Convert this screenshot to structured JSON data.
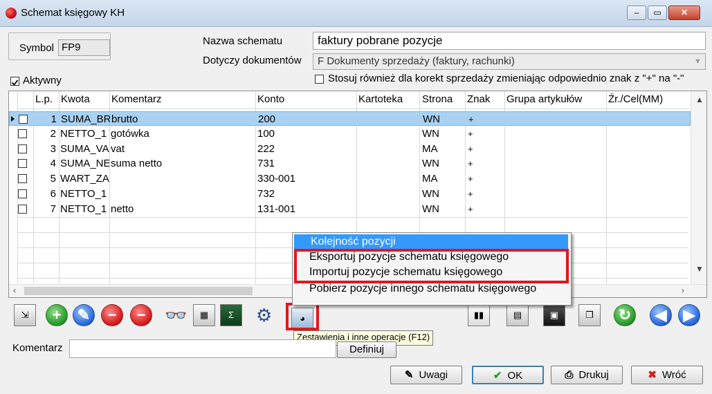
{
  "window": {
    "title": "Schemat księgowy KH",
    "controls": {
      "min": "–",
      "max": "▭",
      "close": "✕"
    }
  },
  "symbol": {
    "label": "Symbol",
    "value": "FP9"
  },
  "name": {
    "label": "Nazwa schematu",
    "value": "faktury pobrane pozycje"
  },
  "documents": {
    "label": "Dotyczy dokumentów",
    "value": "F  Dokumenty sprzedaży (faktury, rachunki)"
  },
  "active": {
    "label": "Aktywny",
    "checked": true
  },
  "correction": {
    "label": "Stosuj również dla korekt sprzedaży zmieniając odpowiednio znak z \"+\" na \"-\"",
    "checked": false
  },
  "grid": {
    "columns": [
      "L.p.",
      "Kwota",
      "Komentarz",
      "Konto",
      "Kartoteka",
      "Strona",
      "Znak",
      "Grupa artykułów",
      "Źr./Cel(MM)"
    ],
    "rows": [
      {
        "lp": "1",
        "kwota": "SUMA_BR",
        "komentarz": "brutto",
        "konto": "200",
        "kartoteka": "",
        "strona": "WN",
        "znak": "+"
      },
      {
        "lp": "2",
        "kwota": "NETTO_1",
        "komentarz": "gotówka",
        "konto": "100",
        "kartoteka": "",
        "strona": "WN",
        "znak": "+"
      },
      {
        "lp": "3",
        "kwota": "SUMA_VA",
        "komentarz": "vat",
        "konto": "222",
        "kartoteka": "",
        "strona": "MA",
        "znak": "+"
      },
      {
        "lp": "4",
        "kwota": "SUMA_NE",
        "komentarz": "suma netto",
        "konto": "731",
        "kartoteka": "",
        "strona": "WN",
        "znak": "+"
      },
      {
        "lp": "5",
        "kwota": "WART_ZA",
        "komentarz": "",
        "konto": "330-001",
        "kartoteka": "",
        "strona": "MA",
        "znak": "+"
      },
      {
        "lp": "6",
        "kwota": "NETTO_1",
        "komentarz": "",
        "konto": "732",
        "kartoteka": "",
        "strona": "WN",
        "znak": "+"
      },
      {
        "lp": "7",
        "kwota": "NETTO_1",
        "komentarz": "netto",
        "konto": "131-001",
        "kartoteka": "",
        "strona": "WN",
        "znak": "+"
      }
    ]
  },
  "context_menu": {
    "items": [
      "Kolejność pozycji",
      "Eksportuj pozycje schematu księgowego",
      "Importuj pozycje schematu księgowego",
      "Pobierz pozycje innego schematu księgowego"
    ]
  },
  "tooltip": "Zestawienia i inne operacje (F12)",
  "comment": {
    "label": "Komentarz",
    "value": "",
    "define_button": "Definiuj"
  },
  "buttons": {
    "notes": "Uwagi",
    "ok": "OK",
    "print": "Drukuj",
    "back": "Wróć"
  },
  "colors": {
    "selection": "#a9d2f2",
    "menu_highlight": "#3399ff",
    "callout_red": "#e4161b"
  }
}
